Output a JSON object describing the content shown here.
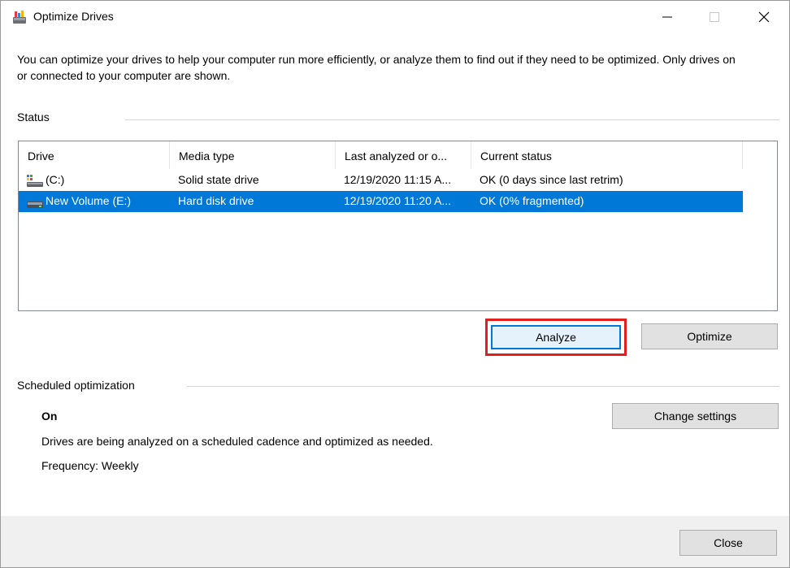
{
  "window": {
    "title": "Optimize Drives",
    "controls": {
      "minimize_icon": "minimize-icon",
      "maximize_icon": "maximize-icon",
      "close_icon": "close-icon"
    }
  },
  "description": "You can optimize your drives to help your computer run more efficiently, or analyze them to find out if they need to be optimized. Only drives on or connected to your computer are shown.",
  "status": {
    "label": "Status",
    "columns": [
      "Drive",
      "Media type",
      "Last analyzed or o...",
      "Current status"
    ],
    "rows": [
      {
        "drive": "(C:)",
        "media_type": "Solid state drive",
        "last_analyzed": "12/19/2020 11:15 A...",
        "current_status": "OK (0 days since last retrim)",
        "icon": "ssd-drive-icon",
        "selected": false
      },
      {
        "drive": "New Volume (E:)",
        "media_type": "Hard disk drive",
        "last_analyzed": "12/19/2020 11:20 A...",
        "current_status": "OK (0% fragmented)",
        "icon": "hdd-drive-icon",
        "selected": true
      }
    ],
    "analyze_label": "Analyze",
    "optimize_label": "Optimize"
  },
  "scheduled": {
    "label": "Scheduled optimization",
    "state": "On",
    "detail": "Drives are being analyzed on a scheduled cadence and optimized as needed.",
    "frequency": "Frequency: Weekly",
    "change_settings_label": "Change settings"
  },
  "footer": {
    "close_label": "Close"
  },
  "colors": {
    "selection": "#0078d7",
    "highlight_box": "#e0201c",
    "button_face": "#e1e1e1",
    "footer_bg": "#f0f0f0"
  }
}
